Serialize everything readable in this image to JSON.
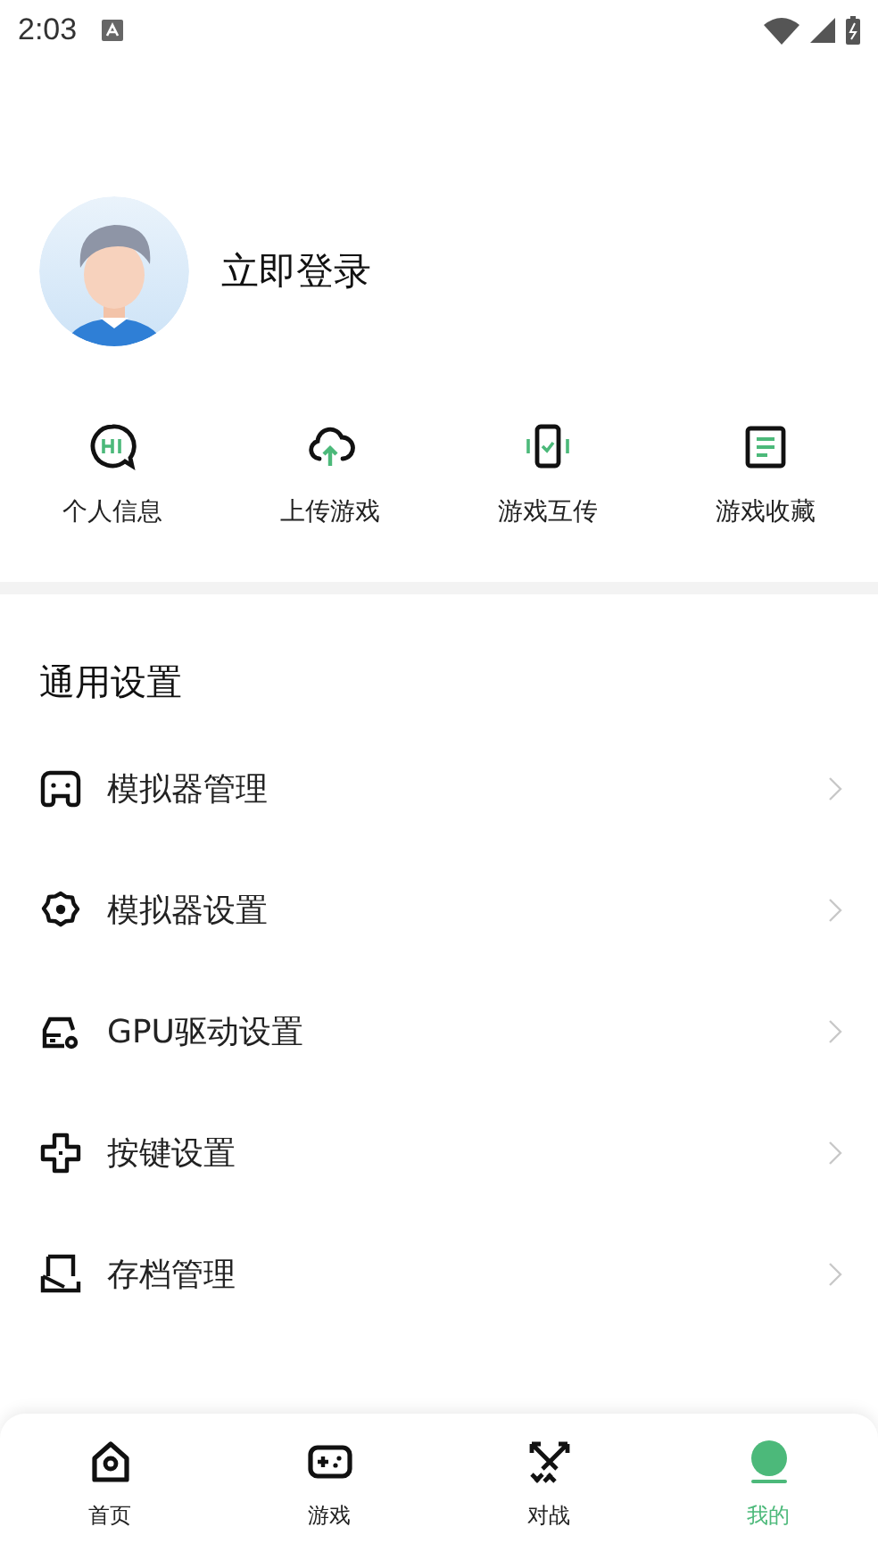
{
  "status_bar": {
    "time": "2:03"
  },
  "profile": {
    "login_label": "立即登录"
  },
  "quick_actions": [
    {
      "kind": "hi",
      "label": "个人信息"
    },
    {
      "kind": "upload",
      "label": "上传游戏"
    },
    {
      "kind": "phone",
      "label": "游戏互传"
    },
    {
      "kind": "doc",
      "label": "游戏收藏"
    }
  ],
  "section_title": "通用设置",
  "settings": [
    {
      "kind": "gamepad",
      "label": "模拟器管理"
    },
    {
      "kind": "gear",
      "label": "模拟器设置"
    },
    {
      "kind": "gpu",
      "label": "GPU驱动设置"
    },
    {
      "kind": "dpad",
      "label": "按键设置"
    },
    {
      "kind": "save",
      "label": "存档管理"
    }
  ],
  "nav": [
    {
      "kind": "home",
      "label": "首页",
      "selected": false
    },
    {
      "kind": "game",
      "label": "游戏",
      "selected": false
    },
    {
      "kind": "battle",
      "label": "对战",
      "selected": false
    },
    {
      "kind": "me",
      "label": "我的",
      "selected": true
    }
  ]
}
